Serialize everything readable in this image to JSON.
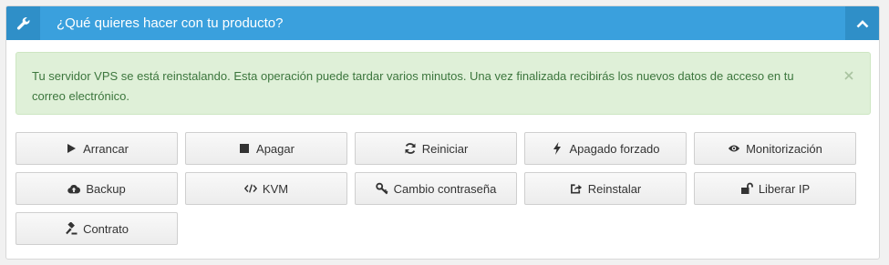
{
  "header": {
    "title": "¿Qué quieres hacer con tu producto?"
  },
  "alert": {
    "message": "Tu servidor VPS se está reinstalando. Esta operación puede tardar varios minutos. Una vez finalizada recibirás los nuevos datos de acceso en tu correo electrónico."
  },
  "actions": {
    "start": "Arrancar",
    "stop": "Apagar",
    "restart": "Reiniciar",
    "force_off": "Apagado forzado",
    "monitoring": "Monitorización",
    "backup": "Backup",
    "kvm": "KVM",
    "change_password": "Cambio contraseña",
    "reinstall": "Reinstalar",
    "release_ip": "Liberar IP",
    "contract": "Contrato"
  },
  "icons": {
    "header_left": "wrench-icon",
    "header_right": "chevron-up-icon",
    "alert_close": "close-icon"
  },
  "colors": {
    "header_bg": "#3aa0dd",
    "header_icon_bg": "#2f8fc8",
    "alert_bg": "#dff0d8",
    "alert_text": "#3c763d"
  }
}
